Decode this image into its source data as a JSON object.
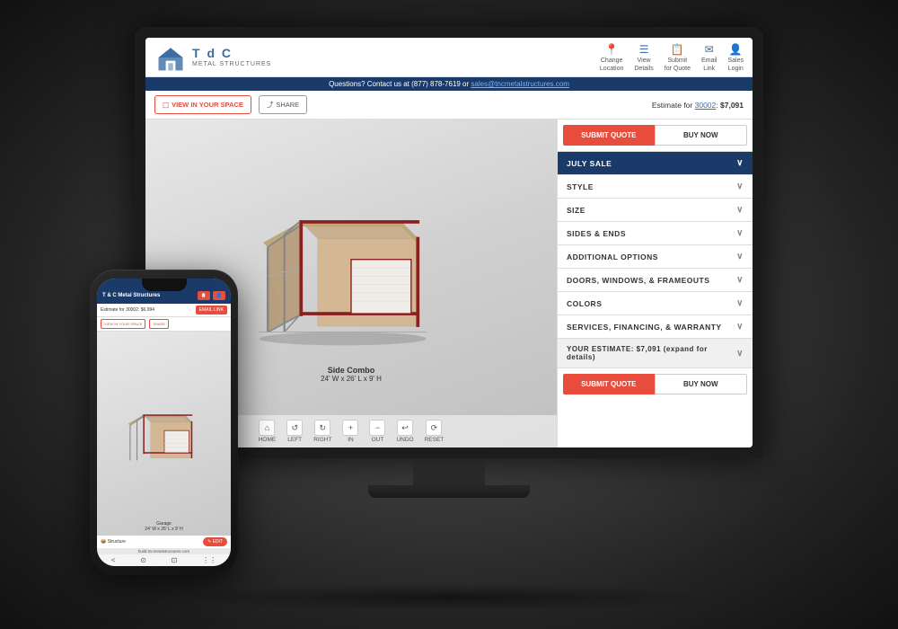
{
  "scene": {
    "background": "#1a1a1a"
  },
  "header": {
    "logo_tc": "T d C",
    "logo_sub": "METAL STRUCTURES",
    "nav_items": [
      {
        "label": "Change\nLocation",
        "icon": "📍"
      },
      {
        "label": "View\nDetails",
        "icon": "☰"
      },
      {
        "label": "Submit\nfor Quote",
        "icon": "📋"
      },
      {
        "label": "Email\nLink",
        "icon": "✉"
      },
      {
        "label": "Sales\nLogin",
        "icon": "👤"
      }
    ]
  },
  "contact_bar": {
    "text": "Questions? Contact us at (877) 878-7619 or",
    "email": "sales@tncmetalstructures.com"
  },
  "toolbar": {
    "view_in_space_label": "VIEW IN YOUR SPACE",
    "share_label": "SHARE",
    "estimate_text": "Estimate for",
    "zip_code": "30002",
    "price": "$7,091"
  },
  "viewer": {
    "building_name": "Side Combo",
    "building_size": "24' W x 26' L x 9' H",
    "nav_buttons": [
      {
        "label": "HOME",
        "icon": "⌂"
      },
      {
        "label": "LEFT",
        "icon": "↺"
      },
      {
        "label": "RIGHT",
        "icon": "↻"
      },
      {
        "label": "IN",
        "icon": "+"
      },
      {
        "label": "OUT",
        "icon": "−"
      },
      {
        "label": "UNDO",
        "icon": "↩"
      },
      {
        "label": "RESET",
        "icon": "⟳"
      }
    ]
  },
  "right_panel": {
    "submit_quote_label": "SUBMIT QUOTE",
    "buy_now_label": "BUY NOW",
    "accordion_items": [
      {
        "label": "JULY SALE",
        "active": true
      },
      {
        "label": "STYLE"
      },
      {
        "label": "SIZE"
      },
      {
        "label": "SIDES & ENDS"
      },
      {
        "label": "ADDITIONAL OPTIONS"
      },
      {
        "label": "DOORS, WINDOWS, & FRAMEOUTS"
      },
      {
        "label": "COLORS"
      },
      {
        "label": "SERVICES, FINANCING, & WARRANTY"
      }
    ],
    "estimate_bar": {
      "label": "YOUR ESTIMATE: $7,091 (expand for details)"
    },
    "bottom_submit": "SUBMIT QUOTE",
    "bottom_buy": "BUY NOW"
  },
  "phone": {
    "logo": "T & C Metal Structures",
    "estimate_label": "Estimate for 30002: $6,994",
    "email_link_label": "EMAIL LINK",
    "view_space_label": "VIEW IN YOUR SPACE",
    "share_label": "SHARE",
    "building_name": "Garage",
    "building_size": "24' W x 26' L x 9' H",
    "edit_label": "✎ EDIT",
    "url": "build.tncmetalstructures.com"
  },
  "colors": {
    "brand_blue": "#1a3a6a",
    "brand_red": "#e74c3c",
    "building_tan": "#d4b896",
    "building_red_trim": "#8b2020",
    "building_white": "#f5f5f0"
  }
}
